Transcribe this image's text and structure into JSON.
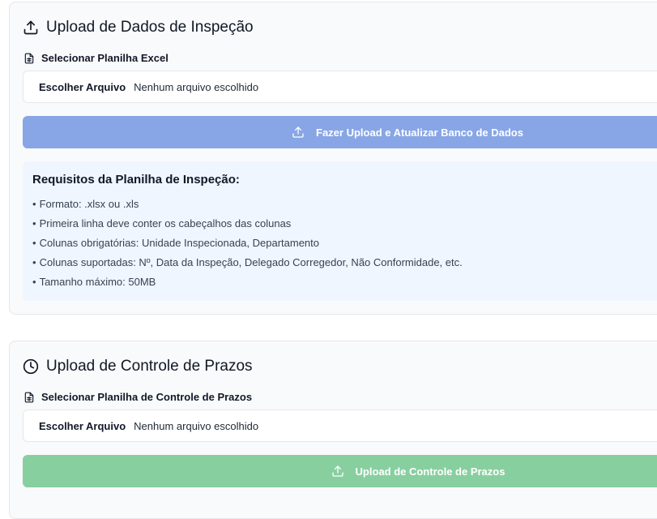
{
  "inspecao": {
    "title": "Upload de Dados de Inspeção",
    "icon": "upload-icon",
    "select_label": "Selecionar Planilha Excel",
    "select_icon": "spreadsheet-icon",
    "file_button": "Escolher Arquivo",
    "file_status": "Nenhum arquivo escolhido",
    "upload_button": "Fazer Upload e Atualizar Banco de Dados",
    "upload_button_color": "#88a6e6",
    "requirements": {
      "title": "Requisitos da Planilha de Inspeção:",
      "items": [
        "Formato: .xlsx ou .xls",
        "Primeira linha deve conter os cabeçalhos das colunas",
        "Colunas obrigatórias: Unidade Inspecionada, Departamento",
        "Colunas suportadas: Nº, Data da Inspeção, Delegado Corregedor, Não Conformidade, etc.",
        "Tamanho máximo: 50MB"
      ]
    }
  },
  "prazos": {
    "title": "Upload de Controle de Prazos",
    "icon": "clock-icon",
    "select_label": "Selecionar Planilha de Controle de Prazos",
    "select_icon": "spreadsheet-icon",
    "file_button": "Escolher Arquivo",
    "file_status": "Nenhum arquivo escolhido",
    "upload_button": "Upload de Controle de Prazos",
    "upload_button_color": "#88cfa0"
  }
}
